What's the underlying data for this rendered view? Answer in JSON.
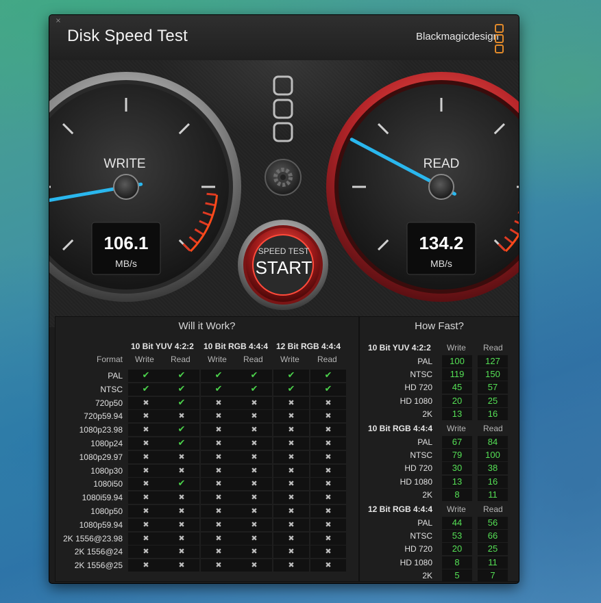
{
  "window": {
    "title": "Disk Speed Test",
    "brand": "Blackmagicdesign",
    "close_glyph": "×"
  },
  "write_gauge": {
    "label": "WRITE",
    "value": "106.1",
    "unit": "MB/s",
    "needle_fraction": 0.13
  },
  "read_gauge": {
    "label": "READ",
    "value": "134.2",
    "unit": "MB/s",
    "needle_fraction": 0.27
  },
  "start_button": {
    "top_label": "SPEED TEST",
    "main_label": "START"
  },
  "settings_icon": "gear-icon",
  "colors": {
    "accent_blue": "#2ab7ee",
    "ok_green": "#4bd14b",
    "speed_green": "#55e055",
    "danger_red": "#e03a22"
  },
  "will_it_work": {
    "title": "Will it Work?",
    "format_label": "Format",
    "groups": [
      {
        "name": "10 Bit YUV 4:2:2",
        "write": "Write",
        "read": "Read"
      },
      {
        "name": "10 Bit RGB 4:4:4",
        "write": "Write",
        "read": "Read"
      },
      {
        "name": "12 Bit RGB 4:4:4",
        "write": "Write",
        "read": "Read"
      }
    ],
    "rows": [
      {
        "format": "PAL",
        "checks": [
          1,
          1,
          1,
          1,
          1,
          1
        ]
      },
      {
        "format": "NTSC",
        "checks": [
          1,
          1,
          1,
          1,
          1,
          1
        ]
      },
      {
        "format": "720p50",
        "checks": [
          0,
          1,
          0,
          0,
          0,
          0
        ]
      },
      {
        "format": "720p59.94",
        "checks": [
          0,
          0,
          0,
          0,
          0,
          0
        ]
      },
      {
        "format": "1080p23.98",
        "checks": [
          0,
          1,
          0,
          0,
          0,
          0
        ]
      },
      {
        "format": "1080p24",
        "checks": [
          0,
          1,
          0,
          0,
          0,
          0
        ]
      },
      {
        "format": "1080p29.97",
        "checks": [
          0,
          0,
          0,
          0,
          0,
          0
        ]
      },
      {
        "format": "1080p30",
        "checks": [
          0,
          0,
          0,
          0,
          0,
          0
        ]
      },
      {
        "format": "1080i50",
        "checks": [
          0,
          1,
          0,
          0,
          0,
          0
        ]
      },
      {
        "format": "1080i59.94",
        "checks": [
          0,
          0,
          0,
          0,
          0,
          0
        ]
      },
      {
        "format": "1080p50",
        "checks": [
          0,
          0,
          0,
          0,
          0,
          0
        ]
      },
      {
        "format": "1080p59.94",
        "checks": [
          0,
          0,
          0,
          0,
          0,
          0
        ]
      },
      {
        "format": "2K 1556@23.98",
        "checks": [
          0,
          0,
          0,
          0,
          0,
          0
        ]
      },
      {
        "format": "2K 1556@24",
        "checks": [
          0,
          0,
          0,
          0,
          0,
          0
        ]
      },
      {
        "format": "2K 1556@25",
        "checks": [
          0,
          0,
          0,
          0,
          0,
          0
        ]
      }
    ],
    "check_glyph": "✔",
    "cross_glyph": "✖"
  },
  "how_fast": {
    "title": "How Fast?",
    "sections": [
      {
        "name": "10 Bit YUV 4:2:2",
        "write": "Write",
        "read": "Read",
        "rows": [
          {
            "format": "PAL",
            "write": "100",
            "read": "127"
          },
          {
            "format": "NTSC",
            "write": "119",
            "read": "150"
          },
          {
            "format": "HD 720",
            "write": "45",
            "read": "57"
          },
          {
            "format": "HD 1080",
            "write": "20",
            "read": "25"
          },
          {
            "format": "2K",
            "write": "13",
            "read": "16"
          }
        ]
      },
      {
        "name": "10 Bit RGB 4:4:4",
        "write": "Write",
        "read": "Read",
        "rows": [
          {
            "format": "PAL",
            "write": "67",
            "read": "84"
          },
          {
            "format": "NTSC",
            "write": "79",
            "read": "100"
          },
          {
            "format": "HD 720",
            "write": "30",
            "read": "38"
          },
          {
            "format": "HD 1080",
            "write": "13",
            "read": "16"
          },
          {
            "format": "2K",
            "write": "8",
            "read": "11"
          }
        ]
      },
      {
        "name": "12 Bit RGB 4:4:4",
        "write": "Write",
        "read": "Read",
        "rows": [
          {
            "format": "PAL",
            "write": "44",
            "read": "56"
          },
          {
            "format": "NTSC",
            "write": "53",
            "read": "66"
          },
          {
            "format": "HD 720",
            "write": "20",
            "read": "25"
          },
          {
            "format": "HD 1080",
            "write": "8",
            "read": "11"
          },
          {
            "format": "2K",
            "write": "5",
            "read": "7"
          }
        ]
      }
    ]
  }
}
